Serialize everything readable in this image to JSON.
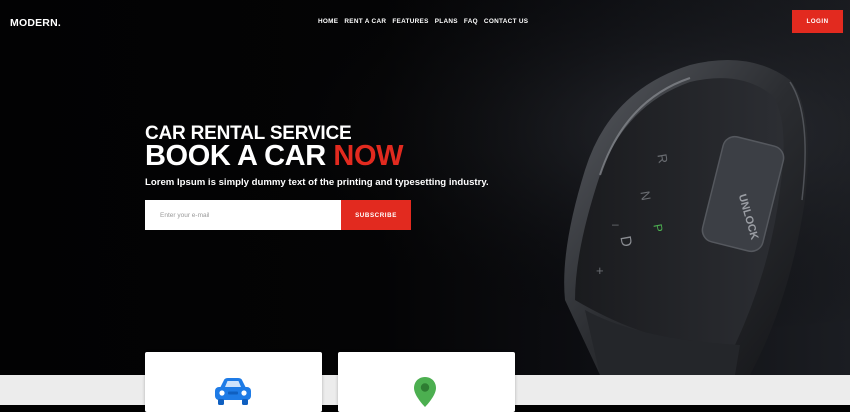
{
  "brand": {
    "logo": "MODERN."
  },
  "nav": {
    "items": [
      "HOME",
      "RENT A CAR",
      "FEATURES",
      "PLANS",
      "FAQ",
      "CONTACT US"
    ],
    "login_label": "LOGIN"
  },
  "hero": {
    "subtitle": "CAR RENTAL SERVICE",
    "title_main": "BOOK A CAR",
    "title_accent": "NOW",
    "lead": "Lorem Ipsum is simply dummy text of the printing and typesetting industry.",
    "email_placeholder": "Enter your e-mail",
    "subscribe_label": "SUBSCRIBE",
    "background_art": {
      "shifter_labels": [
        "R",
        "N",
        "D",
        "P",
        "UNLOCK"
      ]
    }
  },
  "features": {
    "cards": [
      {
        "icon": "car-icon",
        "icon_color": "#1e7be6"
      },
      {
        "icon": "map-pin-icon",
        "icon_color": "#4caf50"
      }
    ]
  },
  "colors": {
    "accent": "#e22a1f",
    "hero_bg": "#050506",
    "band_bg": "#ececec"
  }
}
